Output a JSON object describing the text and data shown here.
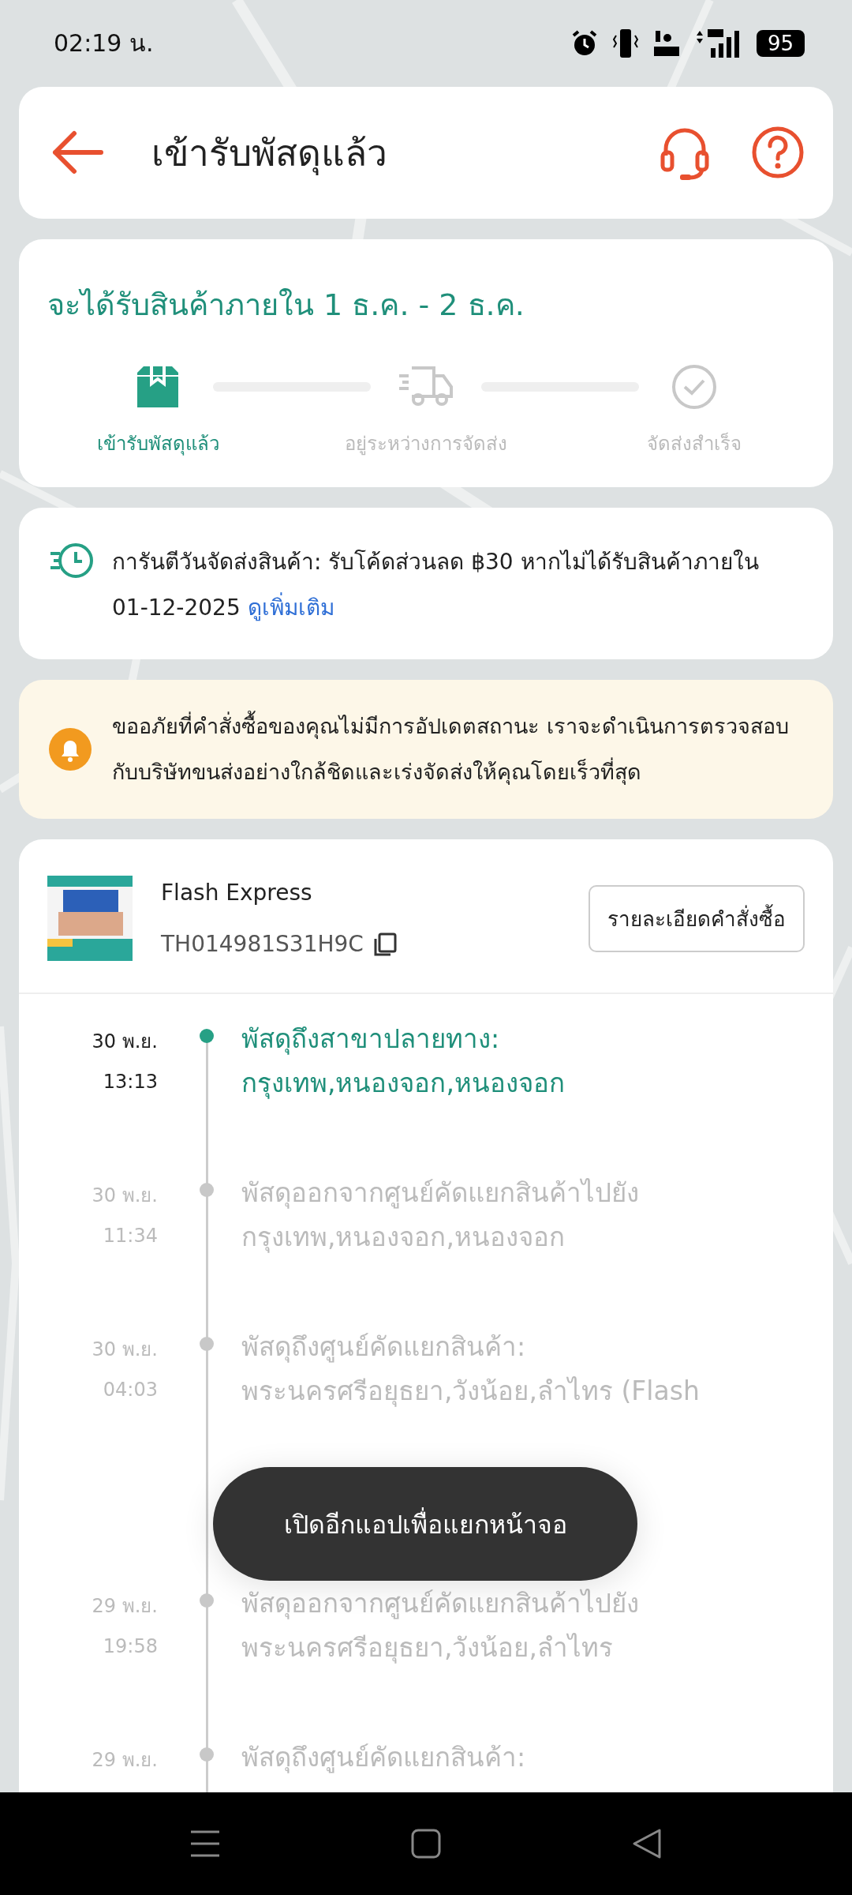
{
  "status_bar": {
    "time": "02:19 น.",
    "battery": "95"
  },
  "header": {
    "title": "เข้ารับพัสดุแล้ว"
  },
  "delivery": {
    "estimate": "จะได้รับสินค้าภายใน 1 ธ.ค. - 2 ธ.ค.",
    "steps": [
      {
        "kind": "box",
        "label": "เข้ารับพัสดุแล้ว",
        "done": true
      },
      {
        "kind": "truck",
        "label": "อยู่ระหว่างการจัดส่ง",
        "done": false
      },
      {
        "kind": "check",
        "label": "จัดส่งสำเร็จ",
        "done": false
      }
    ]
  },
  "guarantee": {
    "text": "การันตีวันจัดส่งสินค้า: รับโค้ดส่วนลด ฿30 หากไม่ได้รับสินค้าภายใน",
    "date": "01-12-2025",
    "link": "ดูเพิ่มเติม"
  },
  "notice": {
    "text": "ขออภัยที่คำสั่งซื้อของคุณไม่มีการอัปเดตสถานะ เราจะดำเนินการตรวจสอบกับบริษัทขนส่งอย่างใกล้ชิดและเร่งจัดส่งให้คุณโดยเร็วที่สุด"
  },
  "shipment": {
    "carrier": "Flash Express",
    "tracking_number": "TH014981S31H9C",
    "details_button": "รายละเอียดคำสั่งซื้อ"
  },
  "timeline": [
    {
      "date": "30 พ.ย.",
      "time": "13:13",
      "lines": [
        "พัสดุถึงสาขาปลายทาง:",
        "กรุงเทพ,หนองจอก,หนองจอก"
      ],
      "current": true
    },
    {
      "date": "30 พ.ย.",
      "time": "11:34",
      "lines": [
        "พัสดุออกจากศูนย์คัดแยกสินค้าไปยัง",
        "กรุงเทพ,หนองจอก,หนองจอก"
      ],
      "current": false
    },
    {
      "date": "30 พ.ย.",
      "time": "04:03",
      "lines": [
        "พัสดุถึงศูนย์คัดแยกสินค้า:",
        "พระนครศรีอยุธยา,วังน้อย,ลำไทร (Flash"
      ],
      "current": false,
      "hidden_line": true
    },
    {
      "date": "29 พ.ย.",
      "time": "19:58",
      "lines": [
        "พัสดุออกจากศูนย์คัดแยกสินค้าไปยัง",
        "พระนครศรีอยุธยา,วังน้อย,ลำไทร"
      ],
      "current": false
    },
    {
      "date": "29 พ.ย.",
      "lines": [
        "พัสดุถึงศูนย์คัดแยกสินค้า:"
      ],
      "current": false
    }
  ],
  "toast": {
    "text": "เปิดอีกแอปเพื่อแยกหน้าจอ"
  }
}
